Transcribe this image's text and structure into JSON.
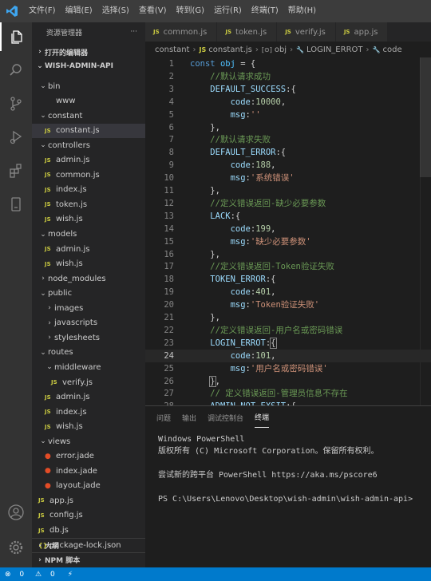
{
  "menu": [
    "文件(F)",
    "编辑(E)",
    "选择(S)",
    "查看(V)",
    "转到(G)",
    "运行(R)",
    "终端(T)",
    "帮助(H)"
  ],
  "sidebar": {
    "title": "资源管理器",
    "more": "···",
    "open_editors": "打开的编辑器",
    "project": "WISH-ADMIN-API",
    "outline": "大纲",
    "npm_scripts": "NPM 脚本"
  },
  "tree": [
    {
      "label": "bin",
      "depth": 1,
      "kind": "folder",
      "expanded": true
    },
    {
      "label": "www",
      "depth": 2,
      "kind": "file"
    },
    {
      "label": "constant",
      "depth": 1,
      "kind": "folder",
      "expanded": true
    },
    {
      "label": "constant.js",
      "depth": 2,
      "kind": "js",
      "selected": true
    },
    {
      "label": "controllers",
      "depth": 1,
      "kind": "folder",
      "expanded": true
    },
    {
      "label": "admin.js",
      "depth": 2,
      "kind": "js"
    },
    {
      "label": "common.js",
      "depth": 2,
      "kind": "js"
    },
    {
      "label": "index.js",
      "depth": 2,
      "kind": "js"
    },
    {
      "label": "token.js",
      "depth": 2,
      "kind": "js"
    },
    {
      "label": "wish.js",
      "depth": 2,
      "kind": "js"
    },
    {
      "label": "models",
      "depth": 1,
      "kind": "folder",
      "expanded": true
    },
    {
      "label": "admin.js",
      "depth": 2,
      "kind": "js"
    },
    {
      "label": "wish.js",
      "depth": 2,
      "kind": "js"
    },
    {
      "label": "node_modules",
      "depth": 1,
      "kind": "folder",
      "expanded": false
    },
    {
      "label": "public",
      "depth": 1,
      "kind": "folder",
      "expanded": true
    },
    {
      "label": "images",
      "depth": 2,
      "kind": "folder",
      "expanded": false
    },
    {
      "label": "javascripts",
      "depth": 2,
      "kind": "folder",
      "expanded": false
    },
    {
      "label": "stylesheets",
      "depth": 2,
      "kind": "folder",
      "expanded": false
    },
    {
      "label": "routes",
      "depth": 1,
      "kind": "folder",
      "expanded": true
    },
    {
      "label": "middleware",
      "depth": 2,
      "kind": "folder",
      "expanded": true
    },
    {
      "label": "verify.js",
      "depth": 3,
      "kind": "js"
    },
    {
      "label": "admin.js",
      "depth": 2,
      "kind": "js"
    },
    {
      "label": "index.js",
      "depth": 2,
      "kind": "js"
    },
    {
      "label": "wish.js",
      "depth": 2,
      "kind": "js"
    },
    {
      "label": "views",
      "depth": 1,
      "kind": "folder",
      "expanded": true
    },
    {
      "label": "error.jade",
      "depth": 2,
      "kind": "jade"
    },
    {
      "label": "index.jade",
      "depth": 2,
      "kind": "jade"
    },
    {
      "label": "layout.jade",
      "depth": 2,
      "kind": "jade"
    },
    {
      "label": "app.js",
      "depth": 1,
      "kind": "js"
    },
    {
      "label": "config.js",
      "depth": 1,
      "kind": "js"
    },
    {
      "label": "db.js",
      "depth": 1,
      "kind": "js"
    },
    {
      "label": "package-lock.json",
      "depth": 1,
      "kind": "json"
    }
  ],
  "tabs": [
    {
      "label": "common.js",
      "active": false
    },
    {
      "label": "token.js",
      "active": false
    },
    {
      "label": "verify.js",
      "active": false
    },
    {
      "label": "app.js",
      "active": false
    }
  ],
  "breadcrumb": [
    "constant",
    "constant.js",
    "obj",
    "LOGIN_ERROT",
    "code"
  ],
  "editor": {
    "current_line": 24,
    "lines": [
      {
        "n": 1,
        "t": [
          [
            "kw",
            "const "
          ],
          [
            "var",
            "obj"
          ],
          [
            "pun",
            " = {"
          ]
        ]
      },
      {
        "n": 2,
        "t": [
          [
            "pun",
            "    "
          ],
          [
            "cmt",
            "//默认请求成功"
          ]
        ]
      },
      {
        "n": 3,
        "t": [
          [
            "pun",
            "    "
          ],
          [
            "prop",
            "DEFAULT_SUCCESS"
          ],
          [
            "pun",
            ":{"
          ]
        ]
      },
      {
        "n": 4,
        "t": [
          [
            "pun",
            "        "
          ],
          [
            "prop",
            "code"
          ],
          [
            "pun",
            ":"
          ],
          [
            "num",
            "10000"
          ],
          [
            "pun",
            ","
          ]
        ]
      },
      {
        "n": 5,
        "t": [
          [
            "pun",
            "        "
          ],
          [
            "prop",
            "msg"
          ],
          [
            "pun",
            ":"
          ],
          [
            "str",
            "''"
          ]
        ]
      },
      {
        "n": 6,
        "t": [
          [
            "pun",
            "    },"
          ]
        ]
      },
      {
        "n": 7,
        "t": [
          [
            "pun",
            "    "
          ],
          [
            "cmt",
            "//默认请求失败"
          ]
        ]
      },
      {
        "n": 8,
        "t": [
          [
            "pun",
            "    "
          ],
          [
            "prop",
            "DEFAULT_ERROR"
          ],
          [
            "pun",
            ":{"
          ]
        ]
      },
      {
        "n": 9,
        "t": [
          [
            "pun",
            "        "
          ],
          [
            "prop",
            "code"
          ],
          [
            "pun",
            ":"
          ],
          [
            "num",
            "188"
          ],
          [
            "pun",
            ","
          ]
        ]
      },
      {
        "n": 10,
        "t": [
          [
            "pun",
            "        "
          ],
          [
            "prop",
            "msg"
          ],
          [
            "pun",
            ":"
          ],
          [
            "str",
            "'系统错误'"
          ]
        ]
      },
      {
        "n": 11,
        "t": [
          [
            "pun",
            "    },"
          ]
        ]
      },
      {
        "n": 12,
        "t": [
          [
            "pun",
            "    "
          ],
          [
            "cmt",
            "//定义错误返回-缺少必要参数"
          ]
        ]
      },
      {
        "n": 13,
        "t": [
          [
            "pun",
            "    "
          ],
          [
            "prop",
            "LACK"
          ],
          [
            "pun",
            ":{"
          ]
        ]
      },
      {
        "n": 14,
        "t": [
          [
            "pun",
            "        "
          ],
          [
            "prop",
            "code"
          ],
          [
            "pun",
            ":"
          ],
          [
            "num",
            "199"
          ],
          [
            "pun",
            ","
          ]
        ]
      },
      {
        "n": 15,
        "t": [
          [
            "pun",
            "        "
          ],
          [
            "prop",
            "msg"
          ],
          [
            "pun",
            ":"
          ],
          [
            "str",
            "'缺少必要参数'"
          ]
        ]
      },
      {
        "n": 16,
        "t": [
          [
            "pun",
            "    },"
          ]
        ]
      },
      {
        "n": 17,
        "t": [
          [
            "pun",
            "    "
          ],
          [
            "cmt",
            "//定义错误返回-Token验证失败"
          ]
        ]
      },
      {
        "n": 18,
        "t": [
          [
            "pun",
            "    "
          ],
          [
            "prop",
            "TOKEN_ERROR"
          ],
          [
            "pun",
            ":{"
          ]
        ]
      },
      {
        "n": 19,
        "t": [
          [
            "pun",
            "        "
          ],
          [
            "prop",
            "code"
          ],
          [
            "pun",
            ":"
          ],
          [
            "num",
            "401"
          ],
          [
            "pun",
            ","
          ]
        ]
      },
      {
        "n": 20,
        "t": [
          [
            "pun",
            "        "
          ],
          [
            "prop",
            "msg"
          ],
          [
            "pun",
            ":"
          ],
          [
            "str",
            "'Token验证失败'"
          ]
        ]
      },
      {
        "n": 21,
        "t": [
          [
            "pun",
            "    },"
          ]
        ]
      },
      {
        "n": 22,
        "t": [
          [
            "pun",
            "    "
          ],
          [
            "cmt",
            "//定义错误返回-用户名或密码错误"
          ]
        ]
      },
      {
        "n": 23,
        "t": [
          [
            "pun",
            "    "
          ],
          [
            "prop",
            "LOGIN_ERROT"
          ],
          [
            "pun",
            ":"
          ],
          [
            "bm",
            "{"
          ]
        ]
      },
      {
        "n": 24,
        "t": [
          [
            "pun",
            "        "
          ],
          [
            "prop",
            "code"
          ],
          [
            "pun",
            ":"
          ],
          [
            "num",
            "101"
          ],
          [
            "pun",
            ","
          ]
        ]
      },
      {
        "n": 25,
        "t": [
          [
            "pun",
            "        "
          ],
          [
            "prop",
            "msg"
          ],
          [
            "pun",
            ":"
          ],
          [
            "str",
            "'用户名或密码错误'"
          ]
        ]
      },
      {
        "n": 26,
        "t": [
          [
            "pun",
            "    "
          ],
          [
            "bm",
            "}"
          ],
          [
            "pun",
            ","
          ]
        ]
      },
      {
        "n": 27,
        "t": [
          [
            "pun",
            "    "
          ],
          [
            "cmt",
            "// 定义错误返回-管理员信息不存在"
          ]
        ]
      },
      {
        "n": 28,
        "t": [
          [
            "pun",
            "    "
          ],
          [
            "prop",
            "ADMIN_NOT_EXSIT"
          ],
          [
            "pun",
            ":{"
          ]
        ]
      }
    ]
  },
  "panel": {
    "tabs": [
      {
        "label": "问题",
        "active": false
      },
      {
        "label": "输出",
        "active": false
      },
      {
        "label": "调试控制台",
        "active": false
      },
      {
        "label": "终端",
        "active": true
      }
    ],
    "terminal_lines": [
      "Windows PowerShell",
      "版权所有 (C) Microsoft Corporation。保留所有权利。",
      "",
      "尝试新的跨平台 PowerShell https://aka.ms/pscore6",
      "",
      "PS C:\\Users\\Lenovo\\Desktop\\wish-admin\\wish-admin-api>"
    ]
  },
  "status": {
    "errors": "0",
    "warnings": "0",
    "sync": "⚡"
  },
  "colors": {
    "statusbar": "#007acc",
    "activity": "#333333",
    "sidebar": "#252526",
    "editor": "#1e1e1e"
  }
}
